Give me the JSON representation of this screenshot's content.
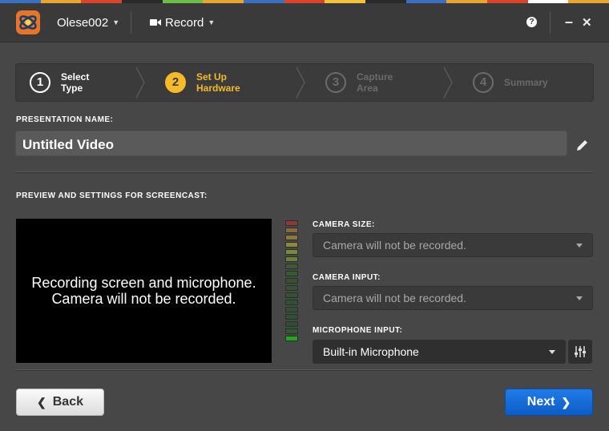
{
  "topbar": {
    "user_menu": "Olese002",
    "record_menu": "Record",
    "help_glyph": "?",
    "minimize_glyph": "–",
    "close_glyph": "✕",
    "stripe_colors": [
      "#3b6fc2",
      "#e8a530",
      "#d9432b",
      "#2a2a2a",
      "#6abf4b",
      "#e8a530",
      "#3b6fc2",
      "#d9432b",
      "#f2c43d",
      "#2a2a2a",
      "#3b6fc2",
      "#e8a530",
      "#d9432b",
      "#ffffff",
      "#e8a530"
    ]
  },
  "wizard": {
    "steps": [
      {
        "number": "1",
        "label": "Select\nType",
        "state": "done"
      },
      {
        "number": "2",
        "label": "Set Up\nHardware",
        "state": "active"
      },
      {
        "number": "3",
        "label": "Capture\nArea",
        "state": "todo"
      },
      {
        "number": "4",
        "label": "Summary",
        "state": "todo"
      }
    ],
    "active_color": "#f5b92a"
  },
  "presentation": {
    "label": "PRESENTATION NAME:",
    "value": "Untitled Video"
  },
  "preview": {
    "section_label": "PREVIEW AND SETTINGS FOR SCREENCAST:",
    "message": "Recording screen and microphone.\nCamera will not be recorded."
  },
  "camera_size": {
    "label": "CAMERA SIZE:",
    "value": "Camera will not be recorded."
  },
  "camera_input": {
    "label": "CAMERA INPUT:",
    "value": "Camera will not be recorded."
  },
  "microphone_input": {
    "label": "MICROPHONE INPUT:",
    "value": "Built-in Microphone"
  },
  "level_meter": {
    "segment_colors": [
      "#8a3a3a",
      "#8a6a3a",
      "#8a7a3a",
      "#8a8a3a",
      "#7a8a3a",
      "#6a7f3a",
      "#3c5a34",
      "#375a33",
      "#345532",
      "#335433",
      "#325332",
      "#315232",
      "#305132",
      "#2f5031",
      "#2e4f31",
      "#2f5a2f",
      "#1fa81f"
    ],
    "level": 0.06
  },
  "footer": {
    "back_label": "Back",
    "next_label": "Next",
    "back_icon": "chevron-left-icon",
    "next_icon": "chevron-right-icon"
  }
}
